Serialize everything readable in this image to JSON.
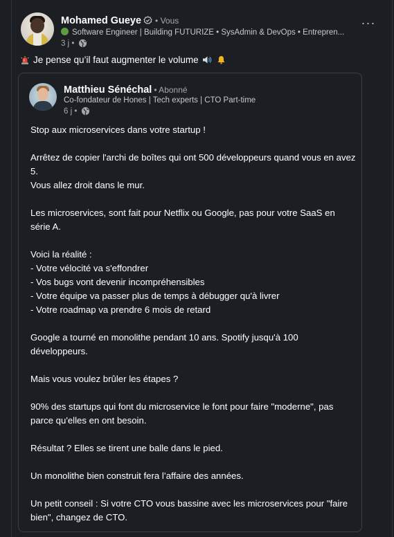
{
  "post": {
    "author": {
      "name": "Mohamed Gueye",
      "relation": "• Vous",
      "headline": "Software Engineer | Building FUTURIZE • SysAdmin & DevOps • Entrepren...",
      "time": "3 j •",
      "verified_icon": "verified-icon",
      "globe_icon": "globe-icon"
    },
    "more_label": "···",
    "commentary": "Je pense qu’il faut augmenter le volume",
    "repost": {
      "author": {
        "name": "Matthieu Sénéchal",
        "relation": "• Abonné",
        "headline": "Co-fondateur de Hones | Tech experts | CTO Part-time",
        "time": "6 j •"
      },
      "body": {
        "p1": "Stop aux microservices dans votre startup !",
        "p2a": "Arrêtez de copier l'archi de boîtes qui ont 500 développeurs quand vous en avez 5.",
        "p2b": "Vous allez droit dans le mur.",
        "p3": "Les microservices, sont fait pour Netflix ou Google, pas pour votre SaaS en série A.",
        "p4_intro": "Voici la réalité :",
        "p4_items": [
          "- Votre vélocité va s'effondrer",
          "- Vos bugs vont devenir incompréhensibles",
          "- Votre équipe va passer plus de temps à débugger qu'à livrer",
          "- Votre roadmap va prendre 6 mois de retard"
        ],
        "p5": "Google a tourné en monolithe pendant 10 ans. Spotify jusqu'à 100 développeurs.",
        "p6": "Mais vous voulez brûler les étapes ?",
        "p7": "90% des startups qui font du microservice le font pour faire \"moderne\", pas parce qu'elles en ont besoin.",
        "p8": "Résultat ? Elles se tirent une balle dans le pied.",
        "p9": "Un monolithe bien construit fera l’affaire des années.",
        "p10": "Un petit conseil : Si votre CTO vous bassine avec les microservices pour \"faire bien\", changez de CTO."
      }
    }
  },
  "colors": {
    "background": "#1b1f23",
    "text": "#ffffff",
    "muted": "#a8a8a8",
    "border": "#3a3f44",
    "status_green": "#5a9e3f"
  }
}
